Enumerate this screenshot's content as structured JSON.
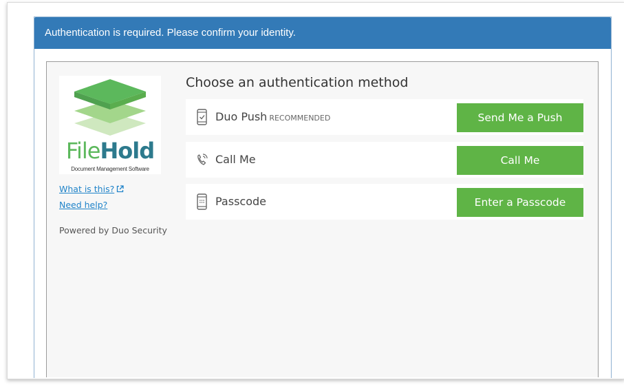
{
  "modal": {
    "title": "Authentication is required. Please confirm your identity."
  },
  "sidebar": {
    "logo": {
      "brand_part1": "File",
      "brand_part2": "Hold",
      "tagline": "Document Management Software"
    },
    "links": [
      {
        "label": "What is this?",
        "icon": "external-link-icon"
      },
      {
        "label": "Need help?"
      }
    ],
    "powered_by": "Powered by Duo Security"
  },
  "auth": {
    "heading": "Choose an authentication method",
    "methods": [
      {
        "label": "Duo Push",
        "badge": "RECOMMENDED",
        "icon": "phone-check-icon",
        "button": "Send Me a Push"
      },
      {
        "label": "Call Me",
        "badge": "",
        "icon": "phone-call-icon",
        "button": "Call Me"
      },
      {
        "label": "Passcode",
        "badge": "",
        "icon": "passcode-device-icon",
        "button": "Enter a Passcode"
      }
    ]
  },
  "colors": {
    "header_blue": "#337ab7",
    "button_green": "#5fb446",
    "link_blue": "#1f83c9",
    "logo_green": "#5cb85c",
    "logo_teal": "#2d7a8d"
  }
}
